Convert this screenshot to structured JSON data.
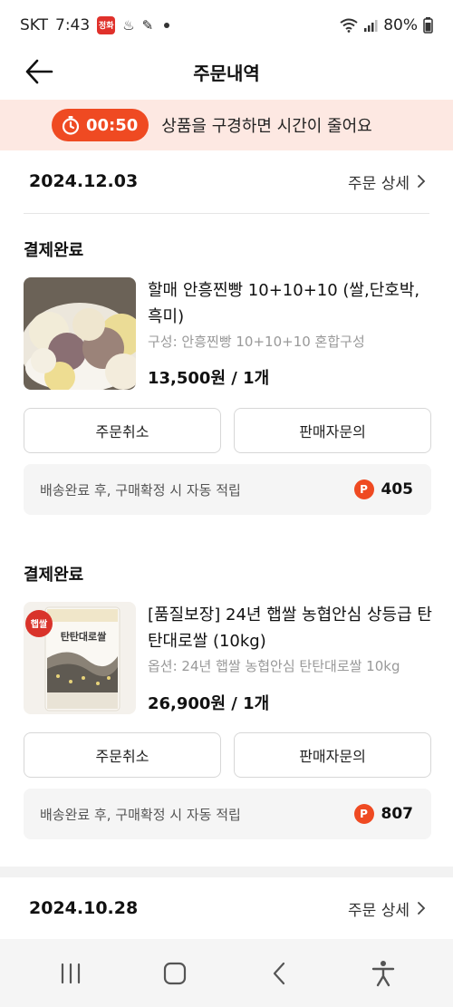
{
  "status_bar": {
    "carrier": "SKT",
    "time": "7:43",
    "badge": "정화",
    "battery": "80%"
  },
  "header": {
    "title": "주문내역"
  },
  "timer_banner": {
    "time": "00:50",
    "message": "상품을 구경하면 시간이 줄어요"
  },
  "orders": [
    {
      "date": "2024.12.03",
      "detail_label": "주문 상세",
      "items": [
        {
          "status": "결제완료",
          "name": "할매 안흥찐빵 10+10+10 (쌀,단호박,흑미)",
          "option": "구성: 안흥찐빵 10+10+10 혼합구성",
          "price": "13,500원 / 1개",
          "cancel_label": "주문취소",
          "inquiry_label": "판매자문의",
          "point_desc": "배송완료 후, 구매확정 시 자동 적립",
          "point_value": "405",
          "thumb": "steamed-buns-image"
        },
        {
          "status": "결제완료",
          "name": "[품질보장] 24년 햅쌀 농협안심 상등급 탄탄대로쌀 (10kg)",
          "option": "옵션: 24년 햅쌀 농협안심 탄탄대로쌀 10kg",
          "price": "26,900원 / 1개",
          "cancel_label": "주문취소",
          "inquiry_label": "판매자문의",
          "point_desc": "배송완료 후, 구매확정 시 자동 적립",
          "point_value": "807",
          "thumb": "rice-bag-image",
          "thumb_label": "탄탄대로쌀",
          "thumb_badge": "햅쌀"
        }
      ]
    },
    {
      "date": "2024.10.28",
      "detail_label": "주문 상세"
    }
  ],
  "icons": {
    "coin": "P"
  },
  "colors": {
    "accent": "#ef4a22",
    "banner_bg": "#fde8e2"
  }
}
